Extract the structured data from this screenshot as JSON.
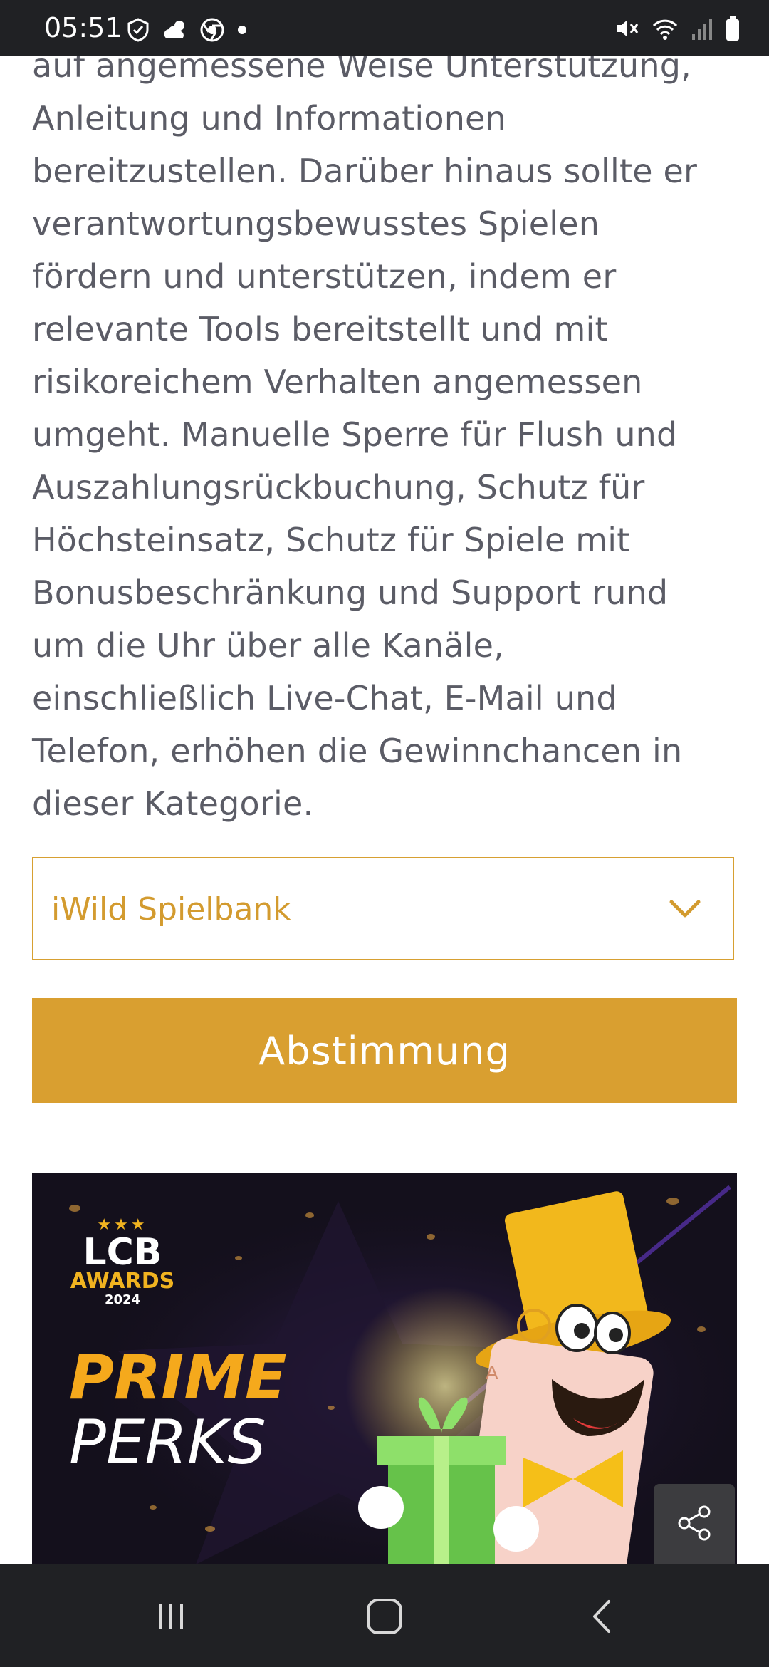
{
  "status_bar": {
    "time": "05:51",
    "left_icons": [
      "shield-check-icon",
      "cloud-sun-icon",
      "chrome-icon",
      "notification-dot-icon"
    ],
    "right_icons": [
      "mute-icon",
      "wifi-icon",
      "signal-icon",
      "battery-icon"
    ]
  },
  "article": {
    "lines": [
      "auf angemessene Weise Unterstützung,",
      "Anleitung und Informationen",
      "bereitzustellen. Darüber hinaus sollte er",
      "verantwortungsbewusstes Spielen",
      "fördern und unterstützen, indem er",
      "relevante Tools bereitstellt und mit",
      "risikoreichem Verhalten angemessen",
      "umgeht. Manuelle Sperre für Flush und",
      "Auszahlungsrückbuchung, Schutz für",
      "Höchsteinsatz, Schutz für Spiele mit",
      "Bonusbeschränkung und Support rund",
      "um die Uhr über alle Kanäle,",
      "einschließlich Live-Chat, E-Mail und",
      "Telefon, erhöhen die Gewinnchancen in",
      "dieser Kategorie."
    ]
  },
  "vote_form": {
    "selected_casino": "iWild Spielbank",
    "vote_label": "Abstimmung"
  },
  "promo": {
    "logo_stars": "★★★",
    "logo_title": "LCB",
    "logo_subtitle": "AWARDS",
    "logo_year": "2024",
    "headline_1": "PRIME",
    "headline_2": "PERKS"
  },
  "colors": {
    "accent": "#d99f30",
    "text": "#5b5c66",
    "banner_bg": "#14101c"
  }
}
